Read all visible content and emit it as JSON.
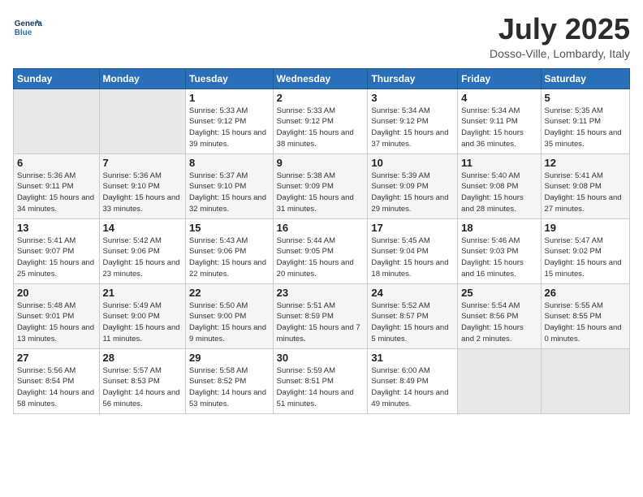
{
  "header": {
    "logo_general": "General",
    "logo_blue": "Blue",
    "month_title": "July 2025",
    "location": "Dosso-Ville, Lombardy, Italy"
  },
  "weekdays": [
    "Sunday",
    "Monday",
    "Tuesday",
    "Wednesday",
    "Thursday",
    "Friday",
    "Saturday"
  ],
  "weeks": [
    [
      {
        "day": "",
        "empty": true
      },
      {
        "day": "",
        "empty": true
      },
      {
        "day": "1",
        "sunrise": "5:33 AM",
        "sunset": "9:12 PM",
        "daylight": "15 hours and 39 minutes."
      },
      {
        "day": "2",
        "sunrise": "5:33 AM",
        "sunset": "9:12 PM",
        "daylight": "15 hours and 38 minutes."
      },
      {
        "day": "3",
        "sunrise": "5:34 AM",
        "sunset": "9:12 PM",
        "daylight": "15 hours and 37 minutes."
      },
      {
        "day": "4",
        "sunrise": "5:34 AM",
        "sunset": "9:11 PM",
        "daylight": "15 hours and 36 minutes."
      },
      {
        "day": "5",
        "sunrise": "5:35 AM",
        "sunset": "9:11 PM",
        "daylight": "15 hours and 35 minutes."
      }
    ],
    [
      {
        "day": "6",
        "sunrise": "5:36 AM",
        "sunset": "9:11 PM",
        "daylight": "15 hours and 34 minutes."
      },
      {
        "day": "7",
        "sunrise": "5:36 AM",
        "sunset": "9:10 PM",
        "daylight": "15 hours and 33 minutes."
      },
      {
        "day": "8",
        "sunrise": "5:37 AM",
        "sunset": "9:10 PM",
        "daylight": "15 hours and 32 minutes."
      },
      {
        "day": "9",
        "sunrise": "5:38 AM",
        "sunset": "9:09 PM",
        "daylight": "15 hours and 31 minutes."
      },
      {
        "day": "10",
        "sunrise": "5:39 AM",
        "sunset": "9:09 PM",
        "daylight": "15 hours and 29 minutes."
      },
      {
        "day": "11",
        "sunrise": "5:40 AM",
        "sunset": "9:08 PM",
        "daylight": "15 hours and 28 minutes."
      },
      {
        "day": "12",
        "sunrise": "5:41 AM",
        "sunset": "9:08 PM",
        "daylight": "15 hours and 27 minutes."
      }
    ],
    [
      {
        "day": "13",
        "sunrise": "5:41 AM",
        "sunset": "9:07 PM",
        "daylight": "15 hours and 25 minutes."
      },
      {
        "day": "14",
        "sunrise": "5:42 AM",
        "sunset": "9:06 PM",
        "daylight": "15 hours and 23 minutes."
      },
      {
        "day": "15",
        "sunrise": "5:43 AM",
        "sunset": "9:06 PM",
        "daylight": "15 hours and 22 minutes."
      },
      {
        "day": "16",
        "sunrise": "5:44 AM",
        "sunset": "9:05 PM",
        "daylight": "15 hours and 20 minutes."
      },
      {
        "day": "17",
        "sunrise": "5:45 AM",
        "sunset": "9:04 PM",
        "daylight": "15 hours and 18 minutes."
      },
      {
        "day": "18",
        "sunrise": "5:46 AM",
        "sunset": "9:03 PM",
        "daylight": "15 hours and 16 minutes."
      },
      {
        "day": "19",
        "sunrise": "5:47 AM",
        "sunset": "9:02 PM",
        "daylight": "15 hours and 15 minutes."
      }
    ],
    [
      {
        "day": "20",
        "sunrise": "5:48 AM",
        "sunset": "9:01 PM",
        "daylight": "15 hours and 13 minutes."
      },
      {
        "day": "21",
        "sunrise": "5:49 AM",
        "sunset": "9:00 PM",
        "daylight": "15 hours and 11 minutes."
      },
      {
        "day": "22",
        "sunrise": "5:50 AM",
        "sunset": "9:00 PM",
        "daylight": "15 hours and 9 minutes."
      },
      {
        "day": "23",
        "sunrise": "5:51 AM",
        "sunset": "8:59 PM",
        "daylight": "15 hours and 7 minutes."
      },
      {
        "day": "24",
        "sunrise": "5:52 AM",
        "sunset": "8:57 PM",
        "daylight": "15 hours and 5 minutes."
      },
      {
        "day": "25",
        "sunrise": "5:54 AM",
        "sunset": "8:56 PM",
        "daylight": "15 hours and 2 minutes."
      },
      {
        "day": "26",
        "sunrise": "5:55 AM",
        "sunset": "8:55 PM",
        "daylight": "15 hours and 0 minutes."
      }
    ],
    [
      {
        "day": "27",
        "sunrise": "5:56 AM",
        "sunset": "8:54 PM",
        "daylight": "14 hours and 58 minutes."
      },
      {
        "day": "28",
        "sunrise": "5:57 AM",
        "sunset": "8:53 PM",
        "daylight": "14 hours and 56 minutes."
      },
      {
        "day": "29",
        "sunrise": "5:58 AM",
        "sunset": "8:52 PM",
        "daylight": "14 hours and 53 minutes."
      },
      {
        "day": "30",
        "sunrise": "5:59 AM",
        "sunset": "8:51 PM",
        "daylight": "14 hours and 51 minutes."
      },
      {
        "day": "31",
        "sunrise": "6:00 AM",
        "sunset": "8:49 PM",
        "daylight": "14 hours and 49 minutes."
      },
      {
        "day": "",
        "empty": true
      },
      {
        "day": "",
        "empty": true
      }
    ]
  ]
}
